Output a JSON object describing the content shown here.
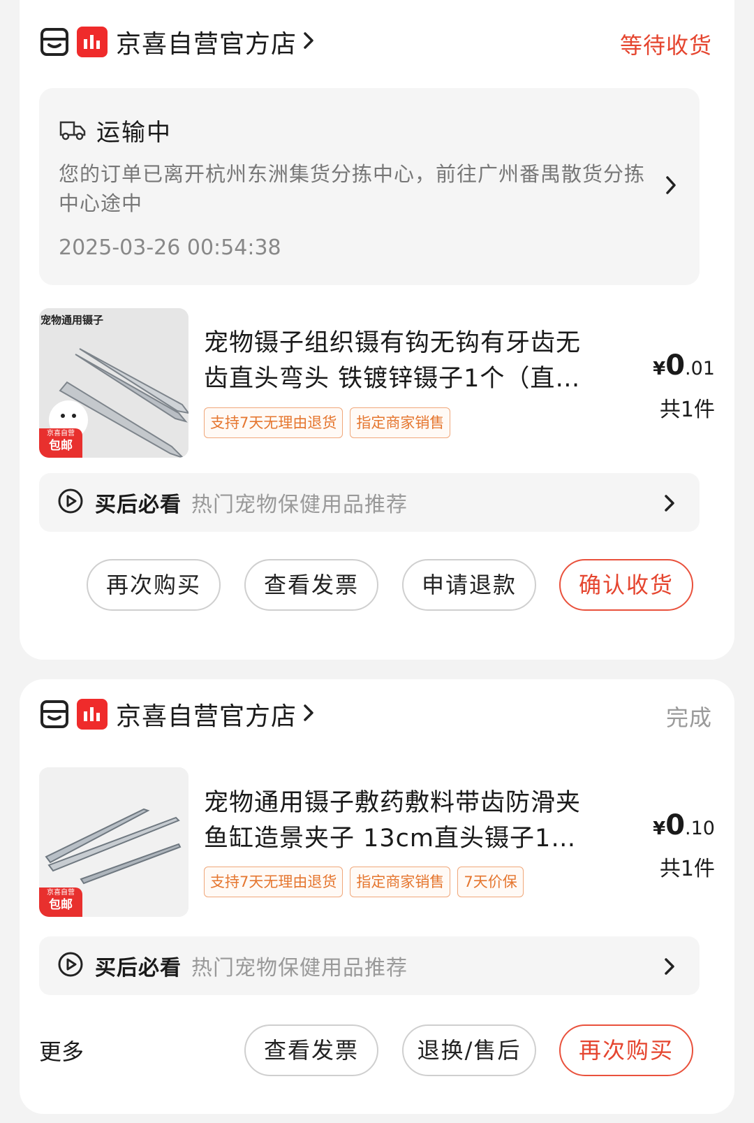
{
  "orders": [
    {
      "shop_name": "京喜自营官方店",
      "status": "等待收货",
      "shipping": {
        "title": "运输中",
        "description": "您的订单已离开杭州东洲集货分拣中心，前往广州番禺散货分拣中心途中",
        "time": "2025-03-26 00:54:38"
      },
      "product": {
        "image_caption": "宠物通用镊子",
        "image_badge_top": "京喜自营",
        "image_badge_bottom": "包邮",
        "title": "宠物镊子组织镊有钩无钩有牙齿无齿直头弯头 铁镀锌镊子1个（直…",
        "price_symbol": "¥",
        "price_int": "0",
        "price_dec": ".01",
        "quantity": "共1件",
        "tags": [
          "支持7天无理由退货",
          "指定商家销售"
        ]
      },
      "recommend": {
        "label": "买后必看",
        "text": "热门宠物保健用品推荐"
      },
      "buttons": [
        "再次购买",
        "查看发票",
        "申请退款",
        "确认收货"
      ]
    },
    {
      "shop_name": "京喜自营官方店",
      "status": "完成",
      "product": {
        "image_badge_top": "京喜自营",
        "image_badge_bottom": "包邮",
        "title": "宠物通用镊子敷药敷料带齿防滑夹鱼缸造景夹子 13cm直头镊子1个…",
        "price_symbol": "¥",
        "price_int": "0",
        "price_dec": ".10",
        "quantity": "共1件",
        "tags": [
          "支持7天无理由退货",
          "指定商家销售",
          "7天价保"
        ]
      },
      "recommend": {
        "label": "买后必看",
        "text": "热门宠物保健用品推荐"
      },
      "more_label": "更多",
      "buttons": [
        "查看发票",
        "退换/售后",
        "再次购买"
      ]
    }
  ],
  "colors": {
    "accent_red": "#e5452f",
    "brand_red": "#ef2b2b",
    "tag_orange": "#e5762f"
  }
}
